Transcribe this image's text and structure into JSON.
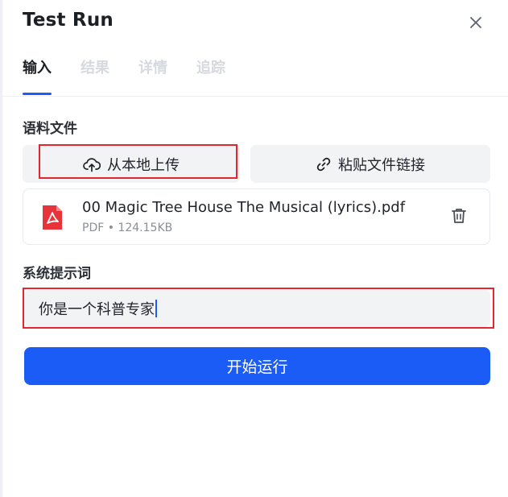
{
  "dialog": {
    "title": "Test Run"
  },
  "tabs": [
    {
      "label": "输入",
      "active": true
    },
    {
      "label": "结果",
      "active": false
    },
    {
      "label": "详情",
      "active": false
    },
    {
      "label": "追踪",
      "active": false
    }
  ],
  "corpus": {
    "section_label": "语料文件",
    "upload_local_label": "从本地上传",
    "paste_link_label": "粘贴文件链接",
    "file": {
      "name": "00 Magic Tree House The Musical (lyrics).pdf",
      "type": "PDF",
      "separator": "•",
      "size": "124.15KB"
    }
  },
  "system_prompt": {
    "section_label": "系统提示词",
    "value": "你是一个科普专家"
  },
  "run_button_label": "开始运行",
  "colors": {
    "accent": "#1a5cf5",
    "pdf_icon": "#e8333a",
    "highlight_box": "#e3262f"
  },
  "icons": {
    "close": "close-icon",
    "upload": "cloud-upload-icon",
    "link": "link-icon",
    "pdf": "pdf-file-icon",
    "delete": "trash-icon"
  }
}
